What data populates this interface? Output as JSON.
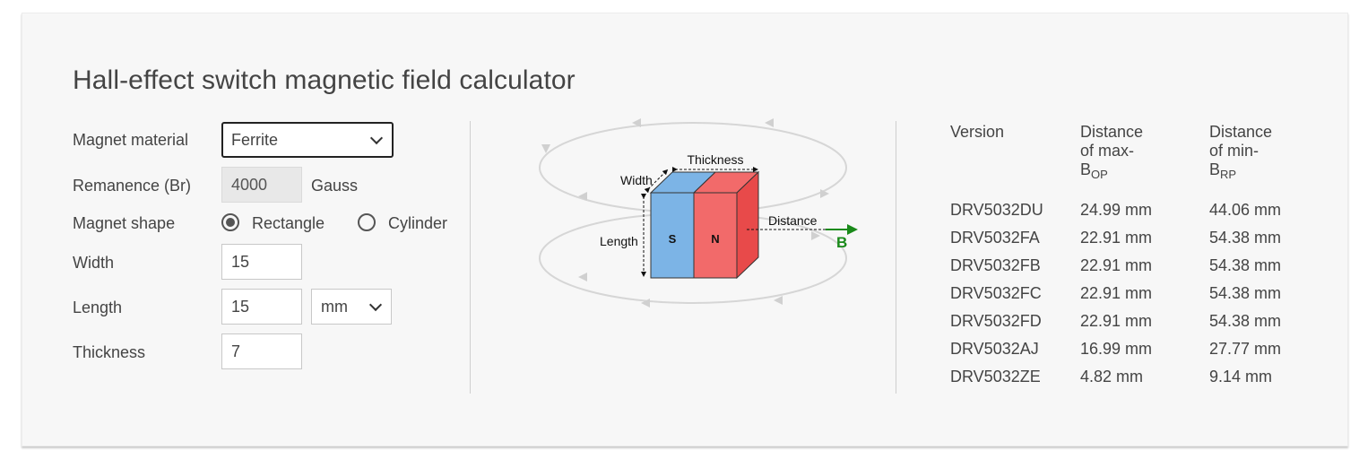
{
  "title": "Hall-effect switch magnetic field calculator",
  "form": {
    "material_label": "Magnet material",
    "material_value": "Ferrite",
    "remanence_label": "Remanence (Br)",
    "remanence_value": "4000",
    "remanence_unit": "Gauss",
    "shape_label": "Magnet shape",
    "shape_options": [
      "Rectangle",
      "Cylinder"
    ],
    "shape_selected": "Rectangle",
    "width_label": "Width",
    "width_value": "15",
    "length_label": "Length",
    "length_value": "15",
    "length_unit": "mm",
    "thickness_label": "Thickness",
    "thickness_value": "7"
  },
  "diagram": {
    "thickness_label": "Thickness",
    "width_label": "Width",
    "length_label": "Length",
    "distance_label": "Distance",
    "south_label": "S",
    "north_label": "N",
    "field_label": "B",
    "south_color": "#7cb4e6",
    "north_color": "#f26a6a",
    "field_color": "#1a8a1a"
  },
  "table": {
    "headers": {
      "version": "Version",
      "col_bop": "Distance of max-",
      "col_bop_symbol": "B",
      "col_bop_sub": "OP",
      "col_brp": "Distance of min-",
      "col_brp_symbol": "B",
      "col_brp_sub": "RP"
    },
    "rows": [
      {
        "version": "DRV5032DU",
        "bop": "24.99 mm",
        "brp": "44.06 mm"
      },
      {
        "version": "DRV5032FA",
        "bop": "22.91 mm",
        "brp": "54.38 mm"
      },
      {
        "version": "DRV5032FB",
        "bop": "22.91 mm",
        "brp": "54.38 mm"
      },
      {
        "version": "DRV5032FC",
        "bop": "22.91 mm",
        "brp": "54.38 mm"
      },
      {
        "version": "DRV5032FD",
        "bop": "22.91 mm",
        "brp": "54.38 mm"
      },
      {
        "version": "DRV5032AJ",
        "bop": "16.99 mm",
        "brp": "27.77 mm"
      },
      {
        "version": "DRV5032ZE",
        "bop": "4.82 mm",
        "brp": "9.14 mm"
      }
    ]
  }
}
